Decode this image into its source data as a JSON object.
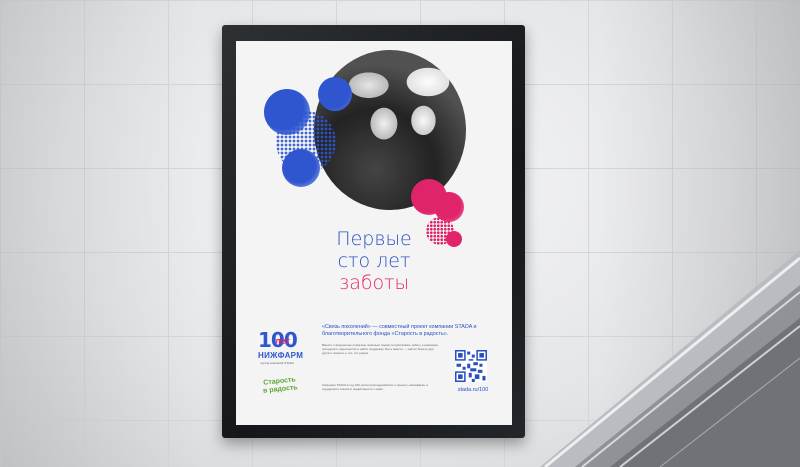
{
  "poster": {
    "headline": [
      "Первые",
      "сто лет",
      "заботы"
    ],
    "logo_number": "100",
    "logo_let": "лет",
    "brand": "НИЖФАРМ",
    "brand_sub": "группа компаний STADA",
    "partner_logo": [
      "Старость",
      "в радость"
    ],
    "intro": "«Связь поколений» — совместный проект компании STADA и благотворительного фонда «Старость в радость».",
    "body_text_1": "Вместе с фондом мы помогаем пожилым людям почувствовать заботу и внимание, преодолеть одиночество и найти поддержку. Быть вместе — значит беречь друг друга и помнить о тех, кто рядом.",
    "body_text_2": "Компании STADA в год 100-летия присоединяйтесь к проекту «Нижфарм» и поддержите пожилых людей вместе с нами.",
    "site": "stada.ru/100",
    "colors": {
      "blue": "#2a4fc1",
      "pink": "#e0246a",
      "green": "#5aa832"
    }
  }
}
